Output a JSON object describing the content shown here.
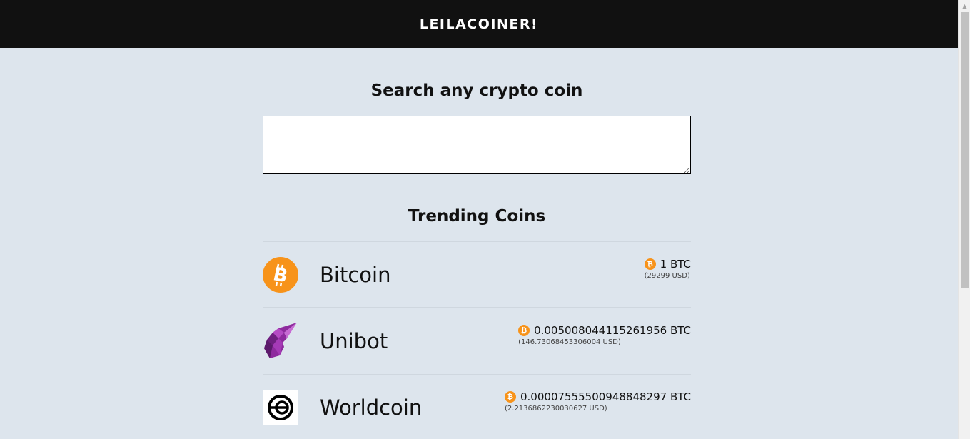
{
  "header": {
    "brand": "LEILACOINER!"
  },
  "search": {
    "title": "Search any crypto coin",
    "value": "",
    "placeholder": ""
  },
  "trending": {
    "title": "Trending Coins",
    "coins": [
      {
        "name": "Bitcoin",
        "icon": "bitcoin-logo-icon",
        "price_btc": "1 BTC",
        "price_usd": "(29299 USD)"
      },
      {
        "name": "Unibot",
        "icon": "unicorn-logo-icon",
        "price_btc": "0.005008044115261956 BTC",
        "price_usd": "(146.73068453306004 USD)"
      },
      {
        "name": "Worldcoin",
        "icon": "worldcoin-logo-icon",
        "price_btc": "0.00007555500948848297 BTC",
        "price_usd": "(2.2136862230030627 USD)"
      }
    ]
  },
  "colors": {
    "topbar": "#111111",
    "background": "#dde5ed",
    "bitcoin": "#f7931a",
    "unibot": "#9b2fae"
  }
}
